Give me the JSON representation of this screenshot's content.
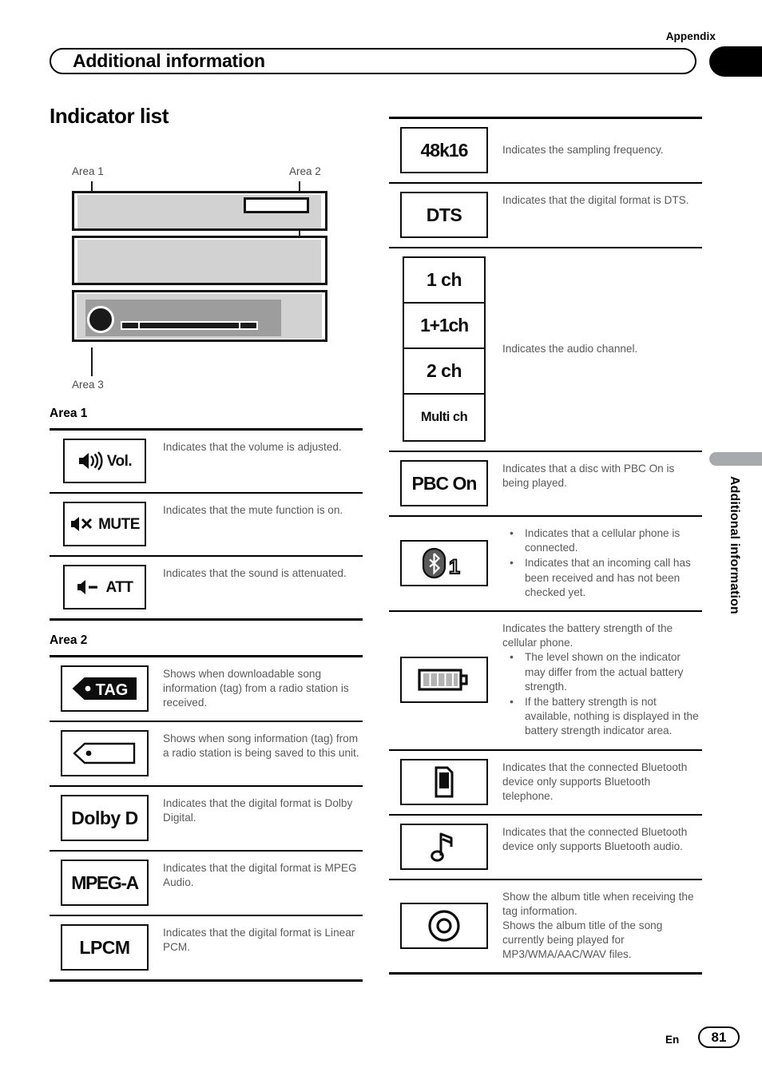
{
  "header": {
    "appendix_label": "Appendix",
    "chapter_title": "Additional information"
  },
  "side_tab": {
    "label": "Additional information"
  },
  "footer": {
    "language": "En",
    "page_number": "81"
  },
  "left_column": {
    "section_title": "Indicator list",
    "diagram": {
      "area1_label": "Area 1",
      "area2_label": "Area 2",
      "area3_label": "Area 3"
    },
    "area1": {
      "title": "Area 1",
      "rows": [
        {
          "icon_name": "volume-indicator",
          "icon_text": "Vol.",
          "description": "Indicates that the volume is adjusted."
        },
        {
          "icon_name": "mute-indicator",
          "icon_text": "MUTE",
          "description": "Indicates that the mute function is on."
        },
        {
          "icon_name": "attenuator-indicator",
          "icon_text": "ATT",
          "description": "Indicates that the sound is attenuated."
        }
      ]
    },
    "area2": {
      "title": "Area 2",
      "rows": [
        {
          "icon_name": "tag-received-indicator",
          "icon_text": "TAG",
          "description": "Shows when downloadable song information (tag) from a radio station is received."
        },
        {
          "icon_name": "tag-saving-indicator",
          "icon_text": "",
          "description": "Shows when song information (tag) from a radio station is being saved to this unit."
        },
        {
          "icon_name": "dolby-digital-indicator",
          "icon_text": "Dolby D",
          "description": "Indicates that the digital format is Dolby Digital."
        },
        {
          "icon_name": "mpeg-audio-indicator",
          "icon_text": "MPEG-A",
          "description": "Indicates that the digital format is MPEG Audio."
        },
        {
          "icon_name": "lpcm-indicator",
          "icon_text": "LPCM",
          "description": "Indicates that the digital format is Linear PCM."
        }
      ]
    }
  },
  "right_column": {
    "rows": [
      {
        "icon_name": "sampling-frequency-indicator",
        "icon_text": "48k16",
        "description": "Indicates the sampling frequency."
      },
      {
        "icon_name": "dts-indicator",
        "icon_text": "DTS",
        "description": "Indicates that the digital format is DTS."
      },
      {
        "icon_name": "audio-channel-indicator-group",
        "icon_text_stack": [
          "1 ch",
          "1+1ch",
          "2 ch",
          "Multi ch"
        ],
        "description": "Indicates the audio channel."
      },
      {
        "icon_name": "pbc-on-indicator",
        "icon_text": "PBC On",
        "description": "Indicates that a disc with PBC On is being played."
      },
      {
        "icon_name": "bluetooth-phone-connected-indicator",
        "icon_text": "1",
        "bullets": [
          "Indicates that a cellular phone is connected.",
          "Indicates that an incoming call has been received and has not been checked yet."
        ]
      },
      {
        "icon_name": "battery-strength-indicator",
        "icon_text": "",
        "description_lead": "Indicates the battery strength of the cellular phone.",
        "bullets": [
          "The level shown on the indicator may differ from the actual battery strength.",
          "If the battery strength is not available, nothing is displayed in the battery strength indicator area."
        ]
      },
      {
        "icon_name": "bluetooth-telephone-only-indicator",
        "icon_text": "",
        "description": "Indicates that the connected Bluetooth device only supports Bluetooth telephone."
      },
      {
        "icon_name": "bluetooth-audio-only-indicator",
        "icon_text": "",
        "description": "Indicates that the connected Bluetooth device only supports Bluetooth audio."
      },
      {
        "icon_name": "album-title-disc-indicator",
        "icon_text": "",
        "description": "Show the album title when receiving the tag information.\nShows the album title of the song currently being played for MP3/WMA/AAC/WAV files."
      }
    ]
  },
  "colors": {
    "ink": "#231f20",
    "body_text": "#58595b",
    "panel_light": "#d2d2d2",
    "panel_mid": "#9d9d9d",
    "side_tab": "#a7a9ac"
  }
}
